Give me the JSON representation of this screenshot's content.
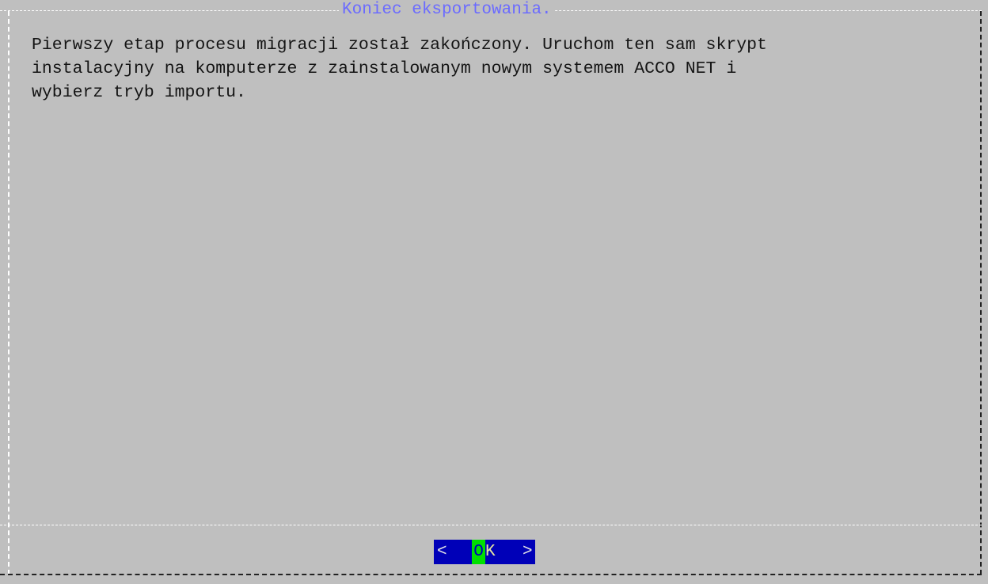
{
  "dialog": {
    "title": "Koniec eksportowania.",
    "message": "Pierwszy etap procesu migracji został zakończony. Uruchom ten sam skrypt\ninstalacyjny na komputerze z zainstalowanym nowym systemem ACCO NET i\nwybierz tryb importu.",
    "ok_button": {
      "left_bracket": "<",
      "hotkey": "O",
      "rest": "K",
      "right_bracket": ">"
    }
  },
  "colors": {
    "background": "#bfbfbf",
    "title": "#6b6bff",
    "button_bg": "#0000b8",
    "button_hotkey_bg": "#00e000"
  }
}
